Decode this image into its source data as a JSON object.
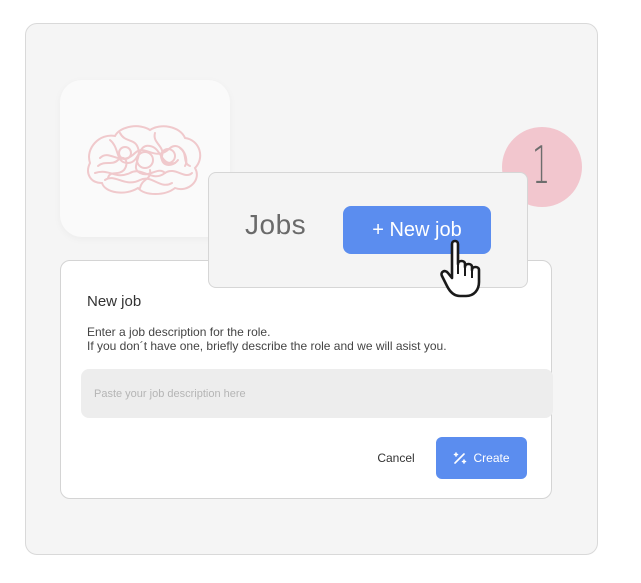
{
  "jobs_header": {
    "title": "Jobs",
    "new_job_label": "+ New job"
  },
  "step_badge": {
    "number": "1"
  },
  "dialog": {
    "title": "New job",
    "description_line1": "Enter a job description for the role.",
    "description_line2": "If you don´t have one, briefly describe the role and we will asist you.",
    "input_placeholder": "Paste your job description here",
    "cancel_label": "Cancel",
    "create_label": "Create"
  },
  "icons": {
    "logo": "brain-icon",
    "cursor": "hand-pointer-icon",
    "create": "magic-wand-icon"
  },
  "colors": {
    "accent": "#5b8def",
    "badge": "#f2c6ce",
    "logo_stroke": "#f0c9cc"
  }
}
